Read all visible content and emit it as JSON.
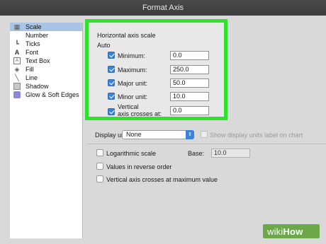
{
  "window": {
    "title": "Format Axis"
  },
  "sidebar": {
    "items": [
      {
        "label": "Scale",
        "icon": "scale-icon"
      },
      {
        "label": "Number",
        "icon": "number-icon"
      },
      {
        "label": "Ticks",
        "icon": "ticks-icon"
      },
      {
        "label": "Font",
        "icon": "font-icon"
      },
      {
        "label": "Text Box",
        "icon": "text-box-icon"
      },
      {
        "label": "Fill",
        "icon": "fill-icon"
      },
      {
        "label": "Line",
        "icon": "line-icon"
      },
      {
        "label": "Shadow",
        "icon": "shadow-icon"
      },
      {
        "label": "Glow & Soft Edges",
        "icon": "glow-icon"
      }
    ]
  },
  "scale": {
    "heading": "Horizontal axis scale",
    "auto_label": "Auto",
    "rows": [
      {
        "label": "Minimum:",
        "value": "0.0",
        "checked": true
      },
      {
        "label": "Maximum:",
        "value": "250.0",
        "checked": true
      },
      {
        "label": "Major unit:",
        "value": "50.0",
        "checked": true
      },
      {
        "label": "Minor unit:",
        "value": "10.0",
        "checked": true
      },
      {
        "label": "Vertical",
        "label2": "axis crosses at:",
        "value": "0.0",
        "checked": true
      }
    ]
  },
  "display_units": {
    "label": "Display units:",
    "value": "None",
    "show_label": "Show display units label on chart"
  },
  "options": {
    "log_label": "Logarithmic scale",
    "base_label": "Base:",
    "base_value": "10.0",
    "reverse_label": "Values in reverse order",
    "max_cross_label": "Vertical axis crosses at maximum value"
  },
  "watermark": {
    "part1": "wiki",
    "part2": "How"
  },
  "colors": {
    "highlight": "#2fe02f",
    "accent": "#3b82d9"
  }
}
